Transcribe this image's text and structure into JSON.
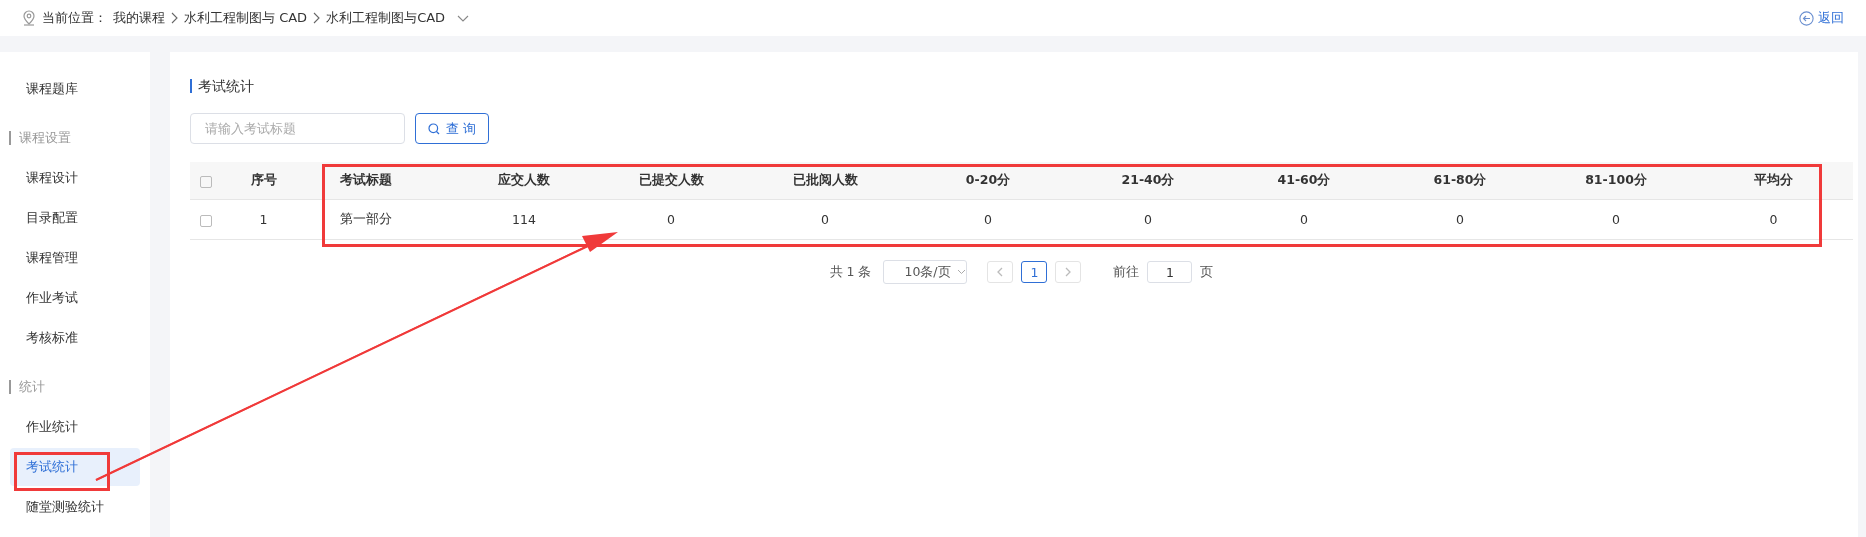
{
  "breadcrumb": {
    "label": "当前位置：",
    "items": [
      "我的课程",
      "水利工程制图与 CAD",
      "水利工程制图与CAD"
    ]
  },
  "back_link": "返回",
  "sidebar": {
    "items": [
      {
        "kind": "item",
        "label": "课程题库",
        "selected": false
      },
      {
        "kind": "heading",
        "label": "课程设置"
      },
      {
        "kind": "item",
        "label": "课程设计",
        "selected": false
      },
      {
        "kind": "item",
        "label": "目录配置",
        "selected": false
      },
      {
        "kind": "item",
        "label": "课程管理",
        "selected": false
      },
      {
        "kind": "item",
        "label": "作业考试",
        "selected": false
      },
      {
        "kind": "item",
        "label": "考核标准",
        "selected": false
      },
      {
        "kind": "heading",
        "label": "统计"
      },
      {
        "kind": "item",
        "label": "作业统计",
        "selected": false
      },
      {
        "kind": "item",
        "label": "考试统计",
        "selected": true
      },
      {
        "kind": "item",
        "label": "随堂测验统计",
        "selected": false
      }
    ]
  },
  "section_title": "考试统计",
  "search": {
    "placeholder": "请输入考试标题",
    "button": "查 询"
  },
  "table": {
    "header_checked": false,
    "columns": [
      "序号",
      "考试标题",
      "应交人数",
      "已提交人数",
      "已批阅人数",
      "0-20分",
      "21-40分",
      "41-60分",
      "61-80分",
      "81-100分",
      "平均分"
    ],
    "rows": [
      {
        "checked": false,
        "cells": [
          "1",
          "第一部分",
          "114",
          "0",
          "0",
          "0",
          "0",
          "0",
          "0",
          "0",
          "0"
        ]
      }
    ]
  },
  "pagination": {
    "total": "共 1 条",
    "page_size": "10条/页",
    "pages": [
      {
        "label": "1",
        "selected": true
      }
    ],
    "goto_label": "前往",
    "goto_value": "1",
    "goto_suffix": "页"
  }
}
